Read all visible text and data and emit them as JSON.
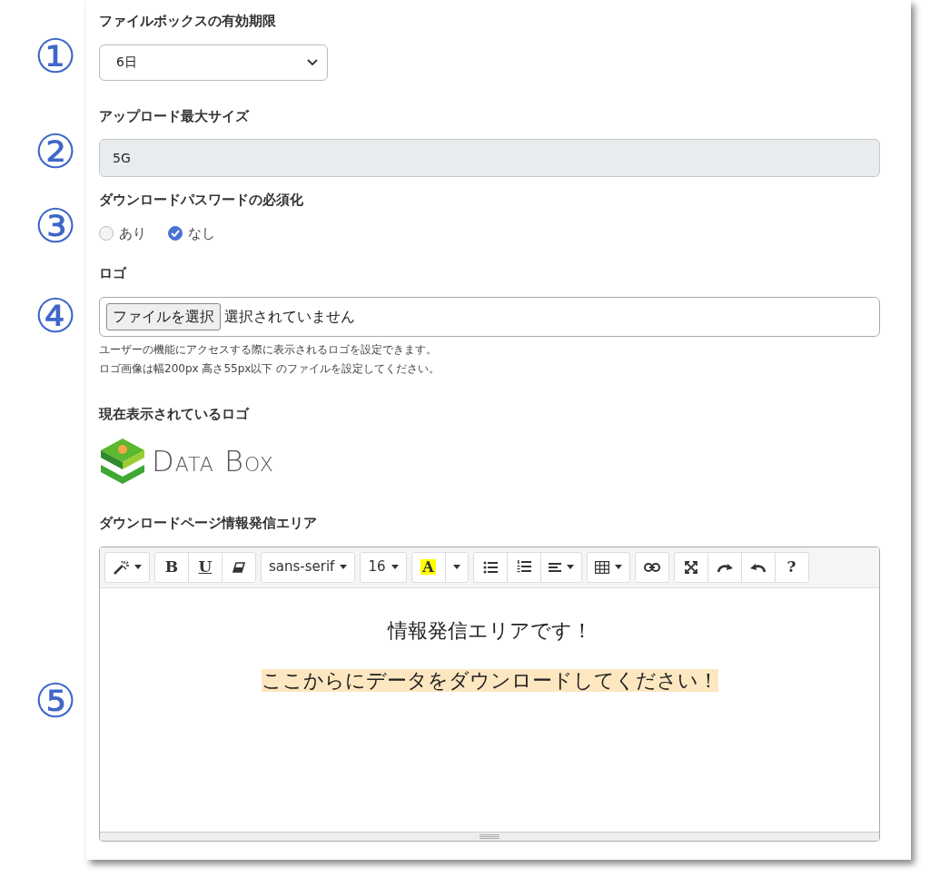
{
  "sections": [
    {
      "marker": "①",
      "label": "ファイルボックスの有効期限",
      "kind": "select",
      "value": "6日"
    },
    {
      "marker": "②",
      "label": "アップロード最大サイズ",
      "kind": "readonly",
      "value": "5G"
    },
    {
      "marker": "③",
      "label": "ダウンロードパスワードの必須化",
      "kind": "radio",
      "options": [
        {
          "label": "あり",
          "selected": false
        },
        {
          "label": "なし",
          "selected": true
        }
      ]
    },
    {
      "marker": "④",
      "label": "ロゴ",
      "kind": "file",
      "button": "ファイルを選択",
      "status": "選択されていません",
      "help": [
        "ユーザーの機能にアクセスする際に表示されるロゴを設定できます。",
        "ロゴ画像は幅200px 高さ55px以下 のファイルを設定してください。"
      ]
    },
    {
      "label": "現在表示されているロゴ",
      "kind": "logo",
      "logo_words": [
        "DATA",
        "BOX"
      ]
    },
    {
      "marker": "⑤",
      "label": "ダウンロードページ情報発信エリア",
      "kind": "editor",
      "toolbar": [
        [
          {
            "kind": "magic",
            "caret": true
          }
        ],
        [
          {
            "kind": "bold",
            "label": "B"
          },
          {
            "kind": "underline",
            "label": "U"
          },
          {
            "kind": "eraser"
          }
        ],
        [
          {
            "kind": "text",
            "label": "sans-serif",
            "caret": true
          }
        ],
        [
          {
            "kind": "text",
            "label": "16",
            "caret": true
          }
        ],
        [
          {
            "kind": "color",
            "label": "A"
          },
          {
            "kind": "caret"
          }
        ],
        [
          {
            "kind": "bullets"
          },
          {
            "kind": "numbers"
          },
          {
            "kind": "align",
            "caret": true
          }
        ],
        [
          {
            "kind": "table",
            "caret": true
          }
        ],
        [
          {
            "kind": "link"
          }
        ],
        [
          {
            "kind": "fullscreen"
          },
          {
            "kind": "redo"
          },
          {
            "kind": "undo"
          },
          {
            "kind": "help",
            "label": "?"
          }
        ]
      ],
      "content": [
        {
          "text": "情報発信エリアです！",
          "highlight": false
        },
        {
          "text": "ここからにデータをダウンロードしてください！",
          "highlight": true
        }
      ]
    }
  ]
}
